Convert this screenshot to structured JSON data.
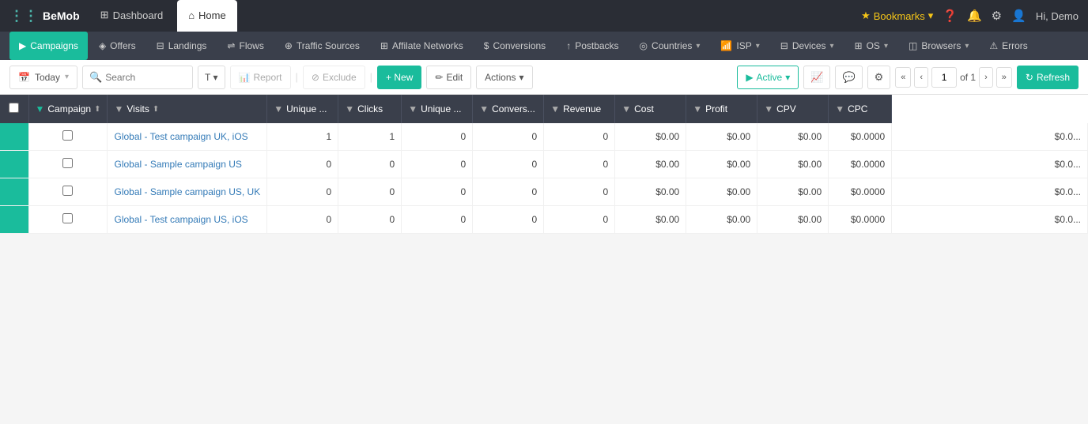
{
  "logo": {
    "icon": "≋",
    "text": "BeMob"
  },
  "top_nav": {
    "tabs": [
      {
        "id": "dashboard",
        "icon": "⊞",
        "label": "Dashboard",
        "active": false
      },
      {
        "id": "home",
        "icon": "⌂",
        "label": "Home",
        "active": true
      }
    ]
  },
  "top_right": {
    "bookmarks_label": "Bookmarks",
    "help_icon": "?",
    "bell_icon": "🔔",
    "settings_icon": "⚙",
    "user_label": "Hi, Demo"
  },
  "second_nav": {
    "items": [
      {
        "id": "campaigns",
        "icon": "▶",
        "label": "Campaigns",
        "active": true,
        "has_chevron": false
      },
      {
        "id": "offers",
        "icon": "◈",
        "label": "Offers",
        "active": false,
        "has_chevron": false
      },
      {
        "id": "landings",
        "icon": "⊟",
        "label": "Landings",
        "active": false,
        "has_chevron": false
      },
      {
        "id": "flows",
        "icon": "⇌",
        "label": "Flows",
        "active": false,
        "has_chevron": false
      },
      {
        "id": "traffic-sources",
        "icon": "⊕",
        "label": "Traffic Sources",
        "active": false,
        "has_chevron": false
      },
      {
        "id": "affiliate-networks",
        "icon": "⊞",
        "label": "Affilate Networks",
        "active": false,
        "has_chevron": false
      },
      {
        "id": "conversions",
        "icon": "$",
        "label": "Conversions",
        "active": false,
        "has_chevron": false
      },
      {
        "id": "postbacks",
        "icon": "↑",
        "label": "Postbacks",
        "active": false,
        "has_chevron": false
      },
      {
        "id": "countries",
        "icon": "◎",
        "label": "Countries",
        "active": false,
        "has_chevron": true
      },
      {
        "id": "isp",
        "icon": "📶",
        "label": "ISP",
        "active": false,
        "has_chevron": true
      },
      {
        "id": "devices",
        "icon": "⊟",
        "label": "Devices",
        "active": false,
        "has_chevron": true
      },
      {
        "id": "os",
        "icon": "⊞",
        "label": "OS",
        "active": false,
        "has_chevron": true
      },
      {
        "id": "browsers",
        "icon": "◫",
        "label": "Browsers",
        "active": false,
        "has_chevron": true
      },
      {
        "id": "errors",
        "icon": "⚠",
        "label": "Errors",
        "active": false,
        "has_chevron": false
      }
    ]
  },
  "toolbar": {
    "date_label": "Today",
    "date_icon": "📅",
    "search_placeholder": "Search",
    "filter_label": "T",
    "report_label": "Report",
    "exclude_label": "Exclude",
    "new_label": "+ New",
    "edit_label": "Edit",
    "actions_label": "Actions",
    "active_label": "Active",
    "chart_icon": "📈",
    "comment_icon": "💬",
    "settings_icon": "⚙",
    "first_page_icon": "«",
    "prev_page_icon": "‹",
    "page_value": "1",
    "page_of": "of 1",
    "next_page_icon": "›",
    "last_page_icon": "»",
    "refresh_label": "Refresh"
  },
  "table": {
    "columns": [
      {
        "id": "select",
        "label": ""
      },
      {
        "id": "campaign",
        "label": "Campaign",
        "sortable": true
      },
      {
        "id": "visits",
        "label": "Visits",
        "sortable": true
      },
      {
        "id": "unique1",
        "label": "Unique ...",
        "sortable": true
      },
      {
        "id": "clicks",
        "label": "Clicks",
        "sortable": true
      },
      {
        "id": "unique2",
        "label": "Unique ...",
        "sortable": true
      },
      {
        "id": "conversions",
        "label": "Convers...",
        "sortable": true
      },
      {
        "id": "revenue",
        "label": "Revenue",
        "sortable": true
      },
      {
        "id": "cost",
        "label": "Cost",
        "sortable": true
      },
      {
        "id": "profit",
        "label": "Profit",
        "sortable": true
      },
      {
        "id": "cpv",
        "label": "CPV",
        "sortable": true
      },
      {
        "id": "cpc",
        "label": "CPC",
        "sortable": true
      }
    ],
    "rows": [
      {
        "id": 1,
        "campaign": "Global - Test campaign UK, iOS",
        "visits": "1",
        "unique1": "1",
        "clicks": "0",
        "unique2": "0",
        "conversions": "0",
        "revenue": "$0.00",
        "cost": "$0.00",
        "profit": "$0.00",
        "cpv": "$0.0000",
        "cpc": "$0.0..."
      },
      {
        "id": 2,
        "campaign": "Global - Sample campaign US",
        "visits": "0",
        "unique1": "0",
        "clicks": "0",
        "unique2": "0",
        "conversions": "0",
        "revenue": "$0.00",
        "cost": "$0.00",
        "profit": "$0.00",
        "cpv": "$0.0000",
        "cpc": "$0.0..."
      },
      {
        "id": 3,
        "campaign": "Global - Sample campaign US, UK",
        "visits": "0",
        "unique1": "0",
        "clicks": "0",
        "unique2": "0",
        "conversions": "0",
        "revenue": "$0.00",
        "cost": "$0.00",
        "profit": "$0.00",
        "cpv": "$0.0000",
        "cpc": "$0.0..."
      },
      {
        "id": 4,
        "campaign": "Global - Test campaign US, iOS",
        "visits": "0",
        "unique1": "0",
        "clicks": "0",
        "unique2": "0",
        "conversions": "0",
        "revenue": "$0.00",
        "cost": "$0.00",
        "profit": "$0.00",
        "cpv": "$0.0000",
        "cpc": "$0.0..."
      }
    ]
  }
}
